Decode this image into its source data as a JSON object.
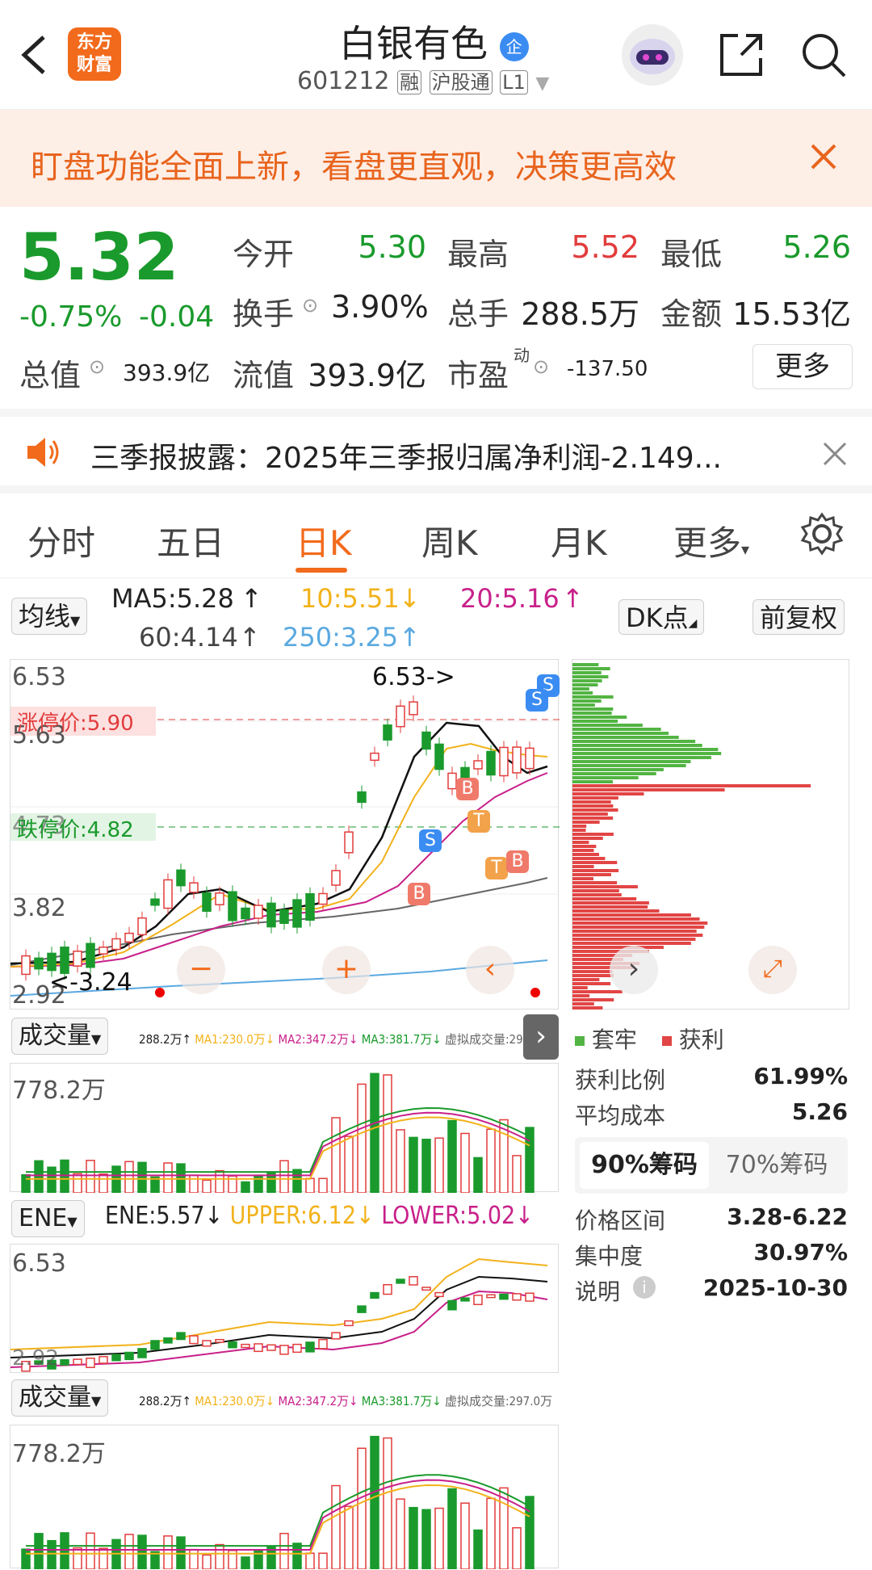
{
  "header": {
    "title": "白银有色",
    "badge": "企",
    "code": "601212",
    "tags": [
      "融",
      "沪股通",
      "L1"
    ],
    "logo_text": "东方财富"
  },
  "banner": {
    "text": "盯盘功能全面上新，看盘更直观，决策更高效"
  },
  "quote": {
    "price": "5.32",
    "change_pct": "-0.75%",
    "change": "-0.04",
    "open_label": "今开",
    "open": "5.30",
    "high_label": "最高",
    "high": "5.52",
    "low_label": "最低",
    "low": "5.26",
    "turnover_label": "换手",
    "turnover": "3.90%",
    "volume_label": "总手",
    "volume": "288.5万",
    "amount_label": "金额",
    "amount": "15.53亿",
    "mktcap_label": "总值",
    "mktcap": "393.9亿",
    "float_label": "流值",
    "float": "393.9亿",
    "pe_label": "市盈",
    "pe_sup": "动",
    "pe": "-137.50",
    "more": "更多"
  },
  "notice": {
    "text": "三季报披露：2025年三季报归属净利润-2.149..."
  },
  "tabs": [
    "分时",
    "五日",
    "日K",
    "周K",
    "月K",
    "更多"
  ],
  "ma": {
    "selector": "均线",
    "ma5": "MA5:5.28",
    "ma10": "10:5.51",
    "ma20": "20:5.16",
    "ma60": "60:4.14",
    "ma250": "250:3.25",
    "dk": "DK点",
    "adj": "前复权"
  },
  "kline": {
    "y_labels": [
      "6.53",
      "5.63",
      "4.73",
      "3.82",
      "2.92"
    ],
    "limit_up": "涨停价:5.90",
    "limit_down": "跌停价:4.82",
    "hi_marker": "6.53->",
    "lo_marker": "<-3.24",
    "signals": [
      "S",
      "S",
      "S",
      "B",
      "B",
      "T",
      "T",
      "B"
    ]
  },
  "vol": {
    "selector": "成交量",
    "info": "288.2万↑",
    "ma1": "MA1:230.0万↓",
    "ma2": "MA2:347.2万↓",
    "ma3": "MA3:381.7万↓",
    "virtual": "虚拟成交量:297.0万",
    "max": "778.2万"
  },
  "ene": {
    "selector": "ENE",
    "ene": "ENE:5.57↓",
    "upper": "UPPER:6.12↓",
    "lower": "LOWER:5.02↓",
    "top": "6.53",
    "bottom": "2.92"
  },
  "chips": {
    "legend_trapped": "套牢",
    "legend_profit": "获利",
    "profit_ratio_label": "获利比例",
    "profit_ratio": "61.99%",
    "avg_cost_label": "平均成本",
    "avg_cost": "5.26",
    "tab90": "90%筹码",
    "tab70": "70%筹码",
    "range_label": "价格区间",
    "range": "3.28-6.22",
    "conc_label": "集中度",
    "conc": "30.97%",
    "note_label": "说明",
    "note": "2025-10-30"
  },
  "colors": {
    "up": "#e23c3c",
    "down": "#1a9a2c",
    "accent": "#f26a1b"
  }
}
